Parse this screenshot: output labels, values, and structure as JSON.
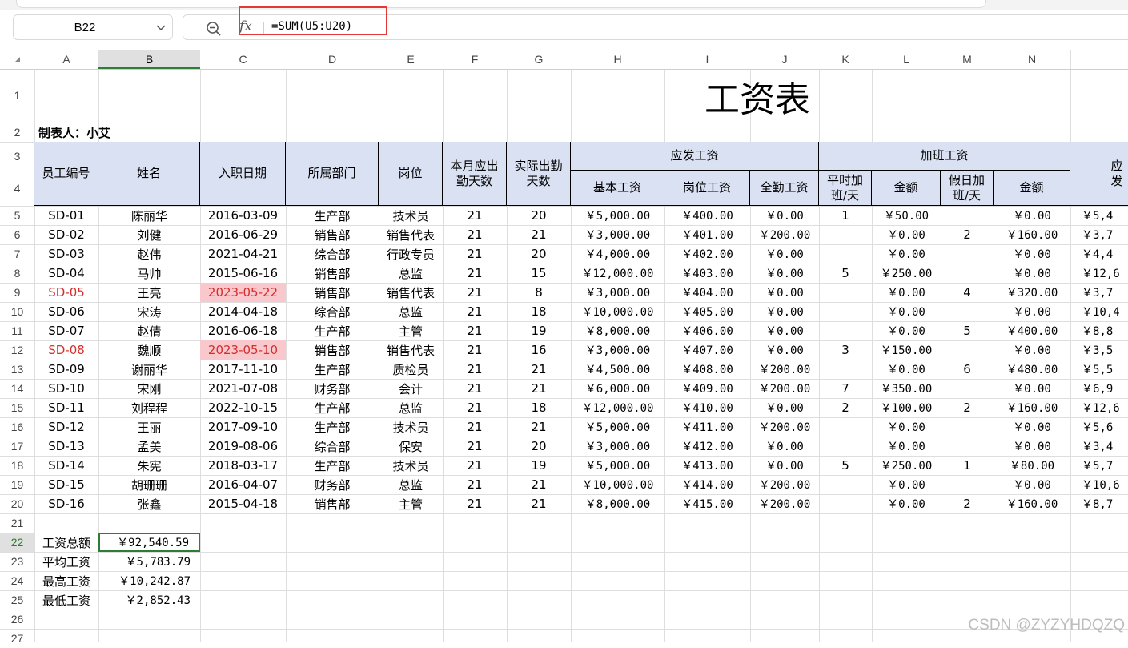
{
  "name_box": "B22",
  "formula_bar": {
    "fx_label": "fx",
    "formula": "=SUM(U5:U20)"
  },
  "column_headers": [
    "A",
    "B",
    "C",
    "D",
    "E",
    "F",
    "G",
    "H",
    "I",
    "J",
    "K",
    "L",
    "M",
    "N"
  ],
  "row_headers": [
    "1",
    "2",
    "3",
    "4",
    "5",
    "6",
    "7",
    "8",
    "9",
    "10",
    "11",
    "12",
    "13",
    "14",
    "15",
    "16",
    "17",
    "18",
    "19",
    "20",
    "21",
    "22",
    "23",
    "24",
    "25",
    "26",
    "27"
  ],
  "sheet": {
    "title": "工资表",
    "maker": "制表人：小艾",
    "headers": {
      "emp_id": "员工编号",
      "name": "姓名",
      "hire_date": "入职日期",
      "dept": "所属部门",
      "position": "岗位",
      "days_due": "本月应出勤天数",
      "days_actual": "实际出勤天数",
      "pay_group": "应发工资",
      "base_pay": "基本工资",
      "post_pay": "岗位工资",
      "attend_bonus": "全勤工资",
      "ot_group": "加班工资",
      "weekday_ot": "平时加班/天",
      "amount1": "金额",
      "holiday_ot": "假日加班/天",
      "amount2": "金额",
      "partial_next": "应发"
    },
    "rows": [
      [
        "SD-01",
        "陈丽华",
        "2016-03-09",
        "生产部",
        "技术员",
        "21",
        "20",
        "￥5,000.00",
        "￥400.00",
        "￥0.00",
        "1",
        "￥50.00",
        "",
        "￥0.00",
        "￥5,4"
      ],
      [
        "SD-02",
        "刘健",
        "2016-06-29",
        "销售部",
        "销售代表",
        "21",
        "21",
        "￥3,000.00",
        "￥401.00",
        "￥200.00",
        "",
        "￥0.00",
        "2",
        "￥160.00",
        "￥3,7"
      ],
      [
        "SD-03",
        "赵伟",
        "2021-04-21",
        "综合部",
        "行政专员",
        "21",
        "20",
        "￥4,000.00",
        "￥402.00",
        "￥0.00",
        "",
        "￥0.00",
        "",
        "￥0.00",
        "￥4,4"
      ],
      [
        "SD-04",
        "马帅",
        "2015-06-16",
        "销售部",
        "总监",
        "21",
        "15",
        "￥12,000.00",
        "￥403.00",
        "￥0.00",
        "5",
        "￥250.00",
        "",
        "￥0.00",
        "￥12,6"
      ],
      [
        "SD-05",
        "王亮",
        "2023-05-22",
        "销售部",
        "销售代表",
        "21",
        "8",
        "￥3,000.00",
        "￥404.00",
        "￥0.00",
        "",
        "￥0.00",
        "4",
        "￥320.00",
        "￥3,7"
      ],
      [
        "SD-06",
        "宋涛",
        "2014-04-18",
        "综合部",
        "总监",
        "21",
        "18",
        "￥10,000.00",
        "￥405.00",
        "￥0.00",
        "",
        "￥0.00",
        "",
        "￥0.00",
        "￥10,4"
      ],
      [
        "SD-07",
        "赵倩",
        "2016-06-18",
        "生产部",
        "主管",
        "21",
        "19",
        "￥8,000.00",
        "￥406.00",
        "￥0.00",
        "",
        "￥0.00",
        "5",
        "￥400.00",
        "￥8,8"
      ],
      [
        "SD-08",
        "魏顺",
        "2023-05-10",
        "销售部",
        "销售代表",
        "21",
        "16",
        "￥3,000.00",
        "￥407.00",
        "￥0.00",
        "3",
        "￥150.00",
        "",
        "￥0.00",
        "￥3,5"
      ],
      [
        "SD-09",
        "谢丽华",
        "2017-11-10",
        "生产部",
        "质检员",
        "21",
        "21",
        "￥4,500.00",
        "￥408.00",
        "￥200.00",
        "",
        "￥0.00",
        "6",
        "￥480.00",
        "￥5,5"
      ],
      [
        "SD-10",
        "宋刚",
        "2021-07-08",
        "财务部",
        "会计",
        "21",
        "21",
        "￥6,000.00",
        "￥409.00",
        "￥200.00",
        "7",
        "￥350.00",
        "",
        "￥0.00",
        "￥6,9"
      ],
      [
        "SD-11",
        "刘程程",
        "2022-10-15",
        "生产部",
        "总监",
        "21",
        "18",
        "￥12,000.00",
        "￥410.00",
        "￥0.00",
        "2",
        "￥100.00",
        "2",
        "￥160.00",
        "￥12,6"
      ],
      [
        "SD-12",
        "王丽",
        "2017-09-10",
        "生产部",
        "技术员",
        "21",
        "21",
        "￥5,000.00",
        "￥411.00",
        "￥200.00",
        "",
        "￥0.00",
        "",
        "￥0.00",
        "￥5,6"
      ],
      [
        "SD-13",
        "孟美",
        "2019-08-06",
        "综合部",
        "保安",
        "21",
        "20",
        "￥3,000.00",
        "￥412.00",
        "￥0.00",
        "",
        "￥0.00",
        "",
        "￥0.00",
        "￥3,4"
      ],
      [
        "SD-14",
        "朱宪",
        "2018-03-17",
        "生产部",
        "技术员",
        "21",
        "19",
        "￥5,000.00",
        "￥413.00",
        "￥0.00",
        "5",
        "￥250.00",
        "1",
        "￥80.00",
        "￥5,7"
      ],
      [
        "SD-15",
        "胡珊珊",
        "2016-04-07",
        "财务部",
        "总监",
        "21",
        "21",
        "￥10,000.00",
        "￥414.00",
        "￥200.00",
        "",
        "￥0.00",
        "",
        "￥0.00",
        "￥10,6"
      ],
      [
        "SD-16",
        "张鑫",
        "2015-04-18",
        "销售部",
        "主管",
        "21",
        "21",
        "￥8,000.00",
        "￥415.00",
        "￥200.00",
        "",
        "￥0.00",
        "2",
        "￥160.00",
        "￥8,7"
      ]
    ],
    "highlighted_rows": [
      "SD-05",
      "SD-08"
    ],
    "summary": [
      {
        "label": "工资总额",
        "value": "￥92,540.59"
      },
      {
        "label": "平均工资",
        "value": "￥5,783.79"
      },
      {
        "label": "最高工资",
        "value": "￥10,242.87"
      },
      {
        "label": "最低工资",
        "value": "￥2,852.43"
      }
    ]
  },
  "watermark": "CSDN @ZYZYHDQZQ",
  "colors": {
    "header_fill": "#d9e1f2",
    "highlight_fill": "#f8c8cc",
    "highlight_text": "#d32f2f",
    "selection": "#2e7d32",
    "annotation": "#e53935"
  }
}
